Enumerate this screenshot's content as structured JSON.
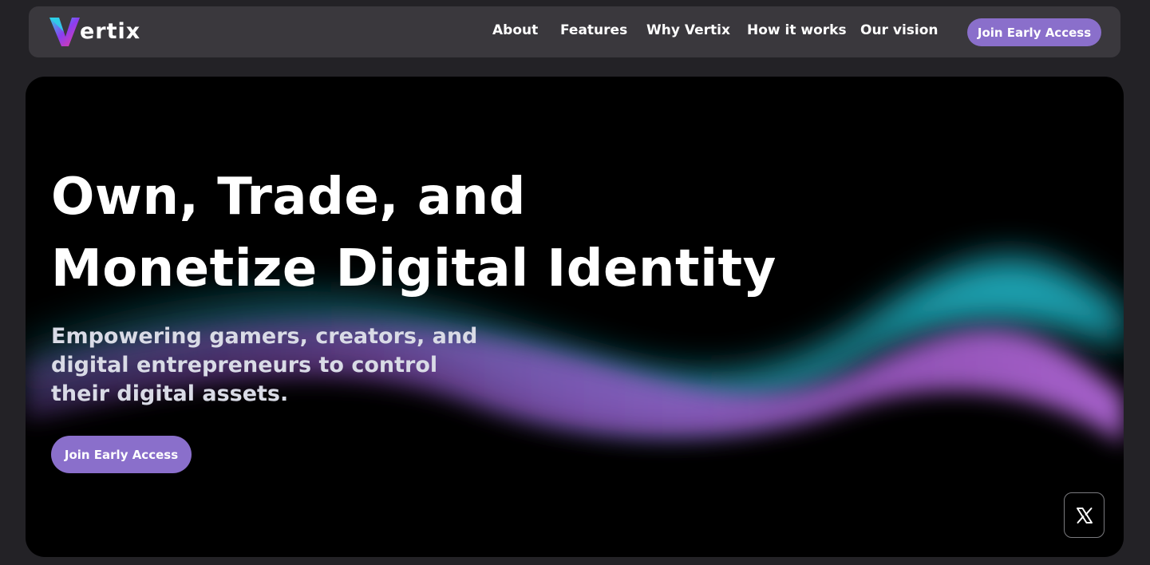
{
  "brand": {
    "name": "Vertix",
    "logo_text": "ertix",
    "accent_gradient": [
      "#2ad3e6",
      "#8b3df0",
      "#f03c9a"
    ]
  },
  "nav": {
    "links": [
      "About",
      "Features",
      "Why Vertix",
      "How it works",
      "Our vision"
    ],
    "cta_label": "Join Early Access",
    "cta_color": "#8a6fcb"
  },
  "hero": {
    "headline_line1": "Own, Trade, and",
    "headline_line2": "Monetize Digital Identity",
    "subtitle": "Empowering gamers, creators, and digital entrepreneurs to control their digital assets.",
    "cta_label": "Join Early Access",
    "wave_colors": [
      "#1fa7b8",
      "#9b55c9"
    ]
  },
  "social": {
    "icon": "x-logo-icon"
  }
}
